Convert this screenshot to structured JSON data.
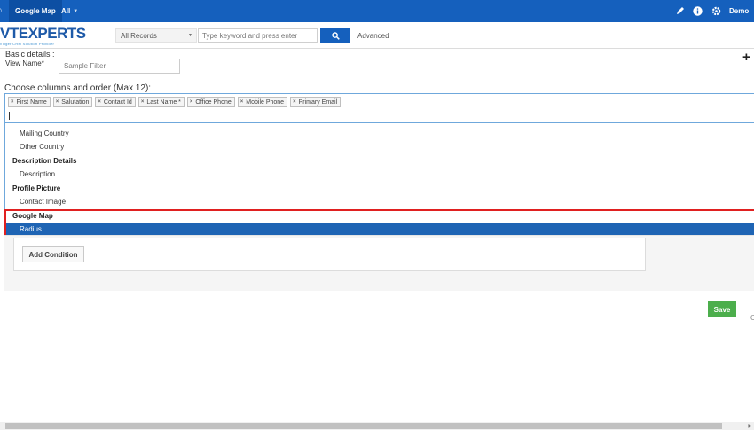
{
  "topbar": {
    "active_tab": "Google Map",
    "all_menu": "All",
    "user": "Demo"
  },
  "brand": {
    "logo_text_left": "VTE",
    "logo_text_x": "X",
    "logo_text_right": "PERTS",
    "tagline": "vTiger CRM Solution Provider"
  },
  "search": {
    "records_select": "All Records",
    "placeholder": "Type keyword and press enter",
    "advanced_label": "Advanced"
  },
  "form": {
    "basic_details_label": "Basic details :",
    "view_name_label": "View Name*",
    "view_name_placeholder": "Sample Filter",
    "columns_label": "Choose columns and order (Max 12):"
  },
  "selected_columns": [
    "First Name",
    "Salutation",
    "Contact Id",
    "Last Name *",
    "Office Phone",
    "Mobile Phone",
    "Primary Email"
  ],
  "dropdown": [
    {
      "type": "option",
      "label": "Mailing Country"
    },
    {
      "type": "option",
      "label": "Other Country"
    },
    {
      "type": "group",
      "label": "Description Details"
    },
    {
      "type": "option",
      "label": "Description"
    },
    {
      "type": "group",
      "label": "Profile Picture"
    },
    {
      "type": "option",
      "label": "Contact Image"
    },
    {
      "type": "group",
      "label": "Google Map"
    },
    {
      "type": "option",
      "label": "Radius",
      "selected": true
    }
  ],
  "conditions": {
    "add_condition_label": "Add Condition"
  },
  "actions": {
    "save_label": "Save",
    "cancel_fragment": "C"
  },
  "colors": {
    "topbar": "#1560bd",
    "selected_option": "#1e64b4",
    "highlight_border": "#e02020",
    "save_button": "#4cae4c"
  }
}
